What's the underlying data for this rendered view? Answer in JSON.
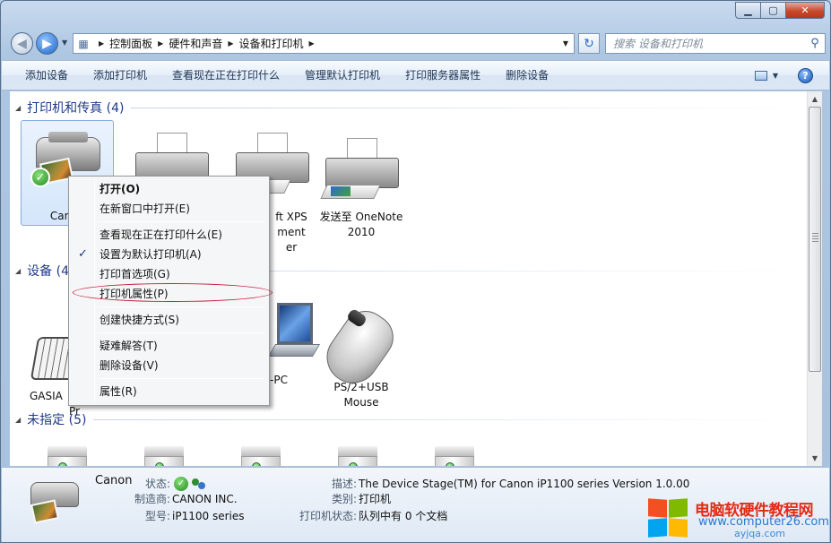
{
  "window": {
    "controls": {
      "minimize": "▁",
      "maximize": "▢",
      "close": "✕"
    }
  },
  "nav": {
    "back_icon": "back-arrow-icon",
    "forward_icon": "forward-arrow-icon",
    "breadcrumb": [
      {
        "label": "控制面板"
      },
      {
        "label": "硬件和声音"
      },
      {
        "label": "设备和打印机"
      }
    ],
    "search_placeholder": "搜索 设备和打印机"
  },
  "toolbar": {
    "items": [
      {
        "label": "添加设备"
      },
      {
        "label": "添加打印机"
      },
      {
        "label": "查看现在正在打印什么"
      },
      {
        "label": "管理默认打印机"
      },
      {
        "label": "打印服务器属性"
      },
      {
        "label": "删除设备"
      }
    ],
    "help_label": "?"
  },
  "groups": {
    "printers": {
      "title": "打印机和传真 (4)",
      "items": [
        {
          "label": "Canon"
        },
        {
          "label": ""
        },
        {
          "label_l1": "ft XPS",
          "label_l2": "ment",
          "label_l3": "er"
        },
        {
          "label_l1": "发送至 OneNote",
          "label_l2": "2010"
        }
      ]
    },
    "devices": {
      "title": "设备 (4",
      "items": [
        {
          "label_l1": "GASIA",
          "label_l2": "Pr"
        },
        {
          "label": "-PC"
        },
        {
          "label_l1": "PS/2+USB",
          "label_l2": "Mouse"
        }
      ]
    },
    "unspecified": {
      "title": "未指定 (5)"
    }
  },
  "context_menu": {
    "items": [
      {
        "label": "打开(O)",
        "bold": true
      },
      {
        "label": "在新窗口中打开(E)"
      },
      {
        "label": "查看现在正在打印什么(E)"
      },
      {
        "label": "设置为默认打印机(A)",
        "checked_icon": "✓"
      },
      {
        "label": "打印首选项(G)"
      },
      {
        "label": "打印机属性(P)"
      },
      {
        "label": "创建快捷方式(S)"
      },
      {
        "label": "疑难解答(T)"
      },
      {
        "label": "删除设备(V)"
      },
      {
        "label": "属性(R)"
      }
    ]
  },
  "details": {
    "name": "Canon",
    "status_key": "状态:",
    "manufacturer_key": "制造商:",
    "manufacturer": "CANON INC.",
    "model_key": "型号:",
    "model": "iP1100 series",
    "desc_key": "描述:",
    "desc": "The Device Stage(TM) for Canon iP1100 series Version 1.0.00",
    "category_key": "类别:",
    "category": "打印机",
    "printer_status_key": "打印机状态:",
    "printer_status": "队列中有 0 个文档"
  },
  "watermark": {
    "title": "电脑软硬件教程网",
    "url": "www.computer26.com",
    "url2": "ayjqa.com"
  }
}
